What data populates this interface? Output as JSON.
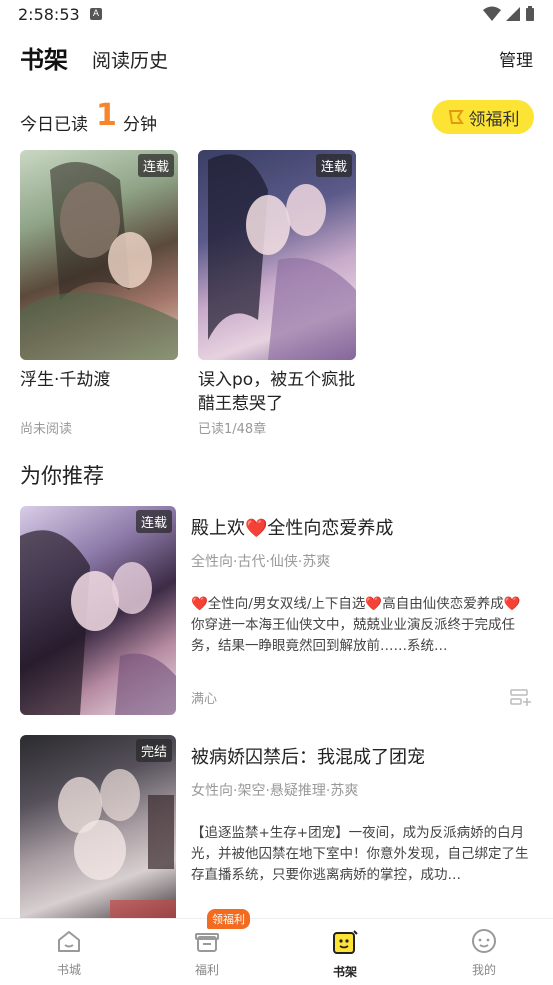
{
  "status_bar": {
    "time": "2:58:53",
    "badge": "A"
  },
  "header": {
    "shelf_tab": "书架",
    "history_tab": "阅读历史",
    "manage": "管理"
  },
  "today": {
    "prefix": "今日已读",
    "minutes": "1",
    "suffix": "分钟"
  },
  "welfare_button": "领福利",
  "shelf_books": [
    {
      "title": "浮生·千劫渡",
      "tag": "连载",
      "progress": "尚未阅读"
    },
    {
      "title": "误入po，被五个疯批醋王惹哭了",
      "tag": "连载",
      "progress": "已读1/48章"
    }
  ],
  "recommend": {
    "title": "为你推荐",
    "items": [
      {
        "title": "殿上欢❤️全性向恋爱养成",
        "tag": "连载",
        "tags": "全性向·古代·仙侠·苏爽",
        "desc": "❤️全性向/男女双线/上下自选❤️高自由仙侠恋爱养成❤️你穿进一本海王仙侠文中，兢兢业业演反派终于完成任务，结果一睁眼竟然回到解放前……系统…",
        "author": "满心"
      },
      {
        "title": "被病娇囚禁后：我混成了团宠",
        "tag": "完结",
        "tags": "女性向·架空·悬疑推理·苏爽",
        "desc": "【追逐监禁+生存+团宠】一夜间，成为反派病娇的白月光，并被他囚禁在地下室中！你意外发现，自己绑定了生存直播系统，只要你逃离病娇的掌控，成功…"
      }
    ]
  },
  "bottom_nav": {
    "items": [
      "书城",
      "福利",
      "书架",
      "我的"
    ],
    "badge": "领福利",
    "active": "书架"
  },
  "colors": {
    "accent": "#f5862d",
    "welfare": "#fce334",
    "badge": "#f26b21"
  }
}
